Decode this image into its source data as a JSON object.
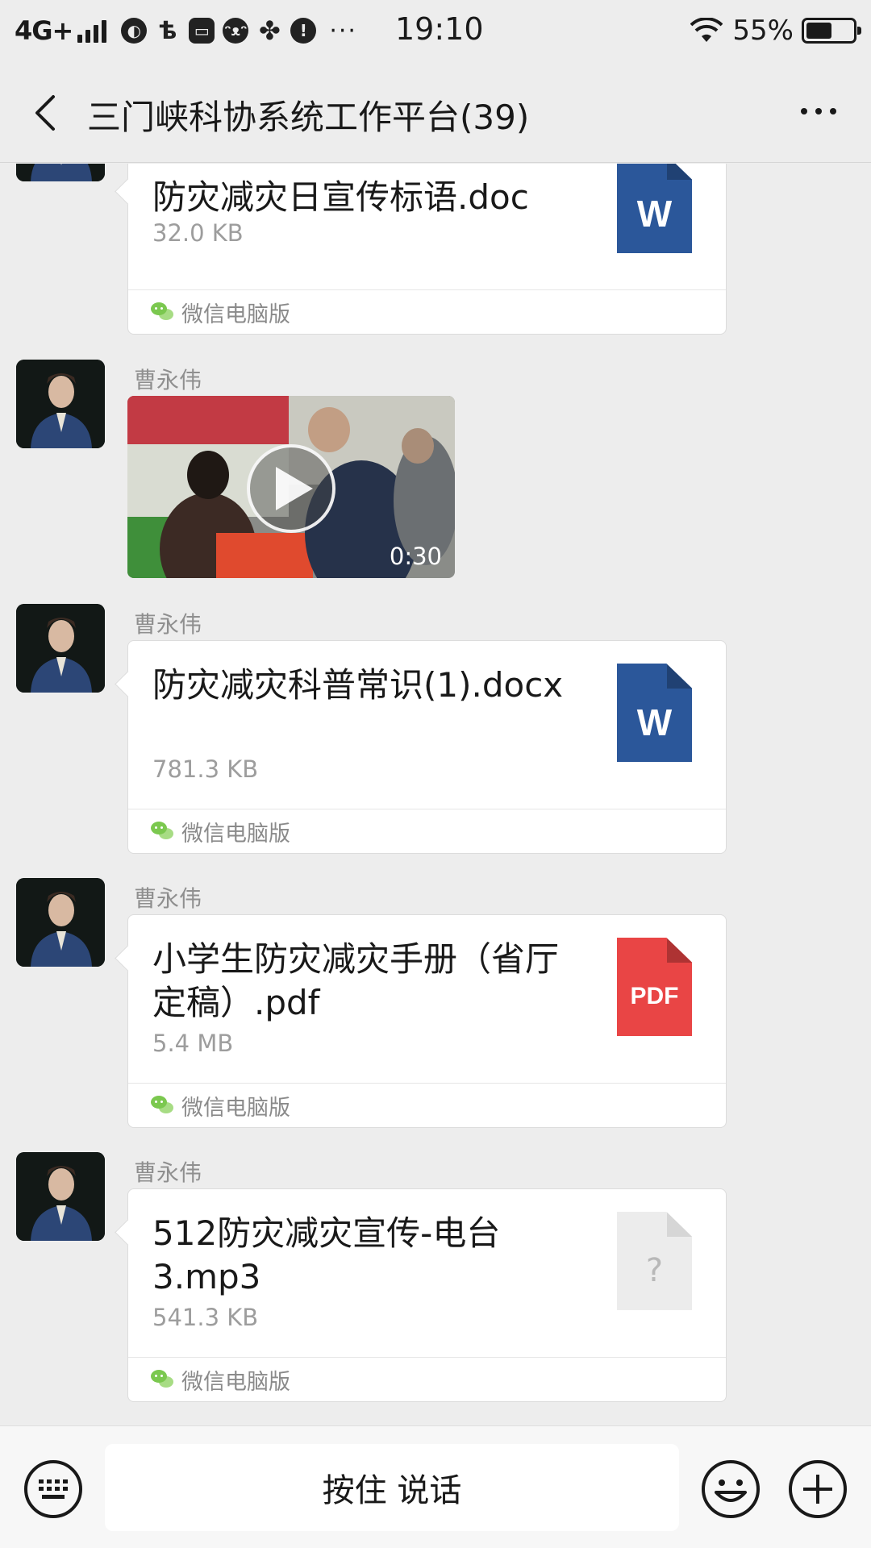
{
  "status_bar": {
    "network": "4G+",
    "time": "19:10",
    "battery_percent": "55%",
    "battery_level": 0.55,
    "more_symbol": "···",
    "icons": [
      "signal-icon",
      "browser-icon",
      "taobao-icon",
      "shop-icon",
      "cat-icon",
      "pinwheel-icon",
      "message-alert-icon"
    ]
  },
  "header": {
    "title": "三门峡科协系统工作平台(39)"
  },
  "messages": [
    {
      "type": "file",
      "sender": "",
      "file_name": "防灾减灾日宣传标语.doc",
      "file_size": "32.0 KB",
      "file_type": "doc",
      "icon_label": "W",
      "source": "微信电脑版"
    },
    {
      "type": "video",
      "sender": "曹永伟",
      "duration": "0:30"
    },
    {
      "type": "file",
      "sender": "曹永伟",
      "file_name": "防灾减灾科普常识(1).docx",
      "file_size": "781.3 KB",
      "file_type": "doc",
      "icon_label": "W",
      "source": "微信电脑版"
    },
    {
      "type": "file",
      "sender": "曹永伟",
      "file_name": "小学生防灾减灾手册（省厅定稿）.pdf",
      "file_size": "5.4 MB",
      "file_type": "pdf",
      "icon_label": "PDF",
      "source": "微信电脑版"
    },
    {
      "type": "file",
      "sender": "曹永伟",
      "file_name": "512防灾减灾宣传-电台3.mp3",
      "file_size": "541.3 KB",
      "file_type": "unknown",
      "icon_label": "?",
      "source": "微信电脑版"
    }
  ],
  "input_bar": {
    "hold_to_talk_label": "按住 说话"
  },
  "colors": {
    "background": "#ededed",
    "bubble": "#ffffff",
    "word_blue": "#2b579a",
    "pdf_red": "#e94545",
    "wechat_green": "#7bc84f"
  }
}
